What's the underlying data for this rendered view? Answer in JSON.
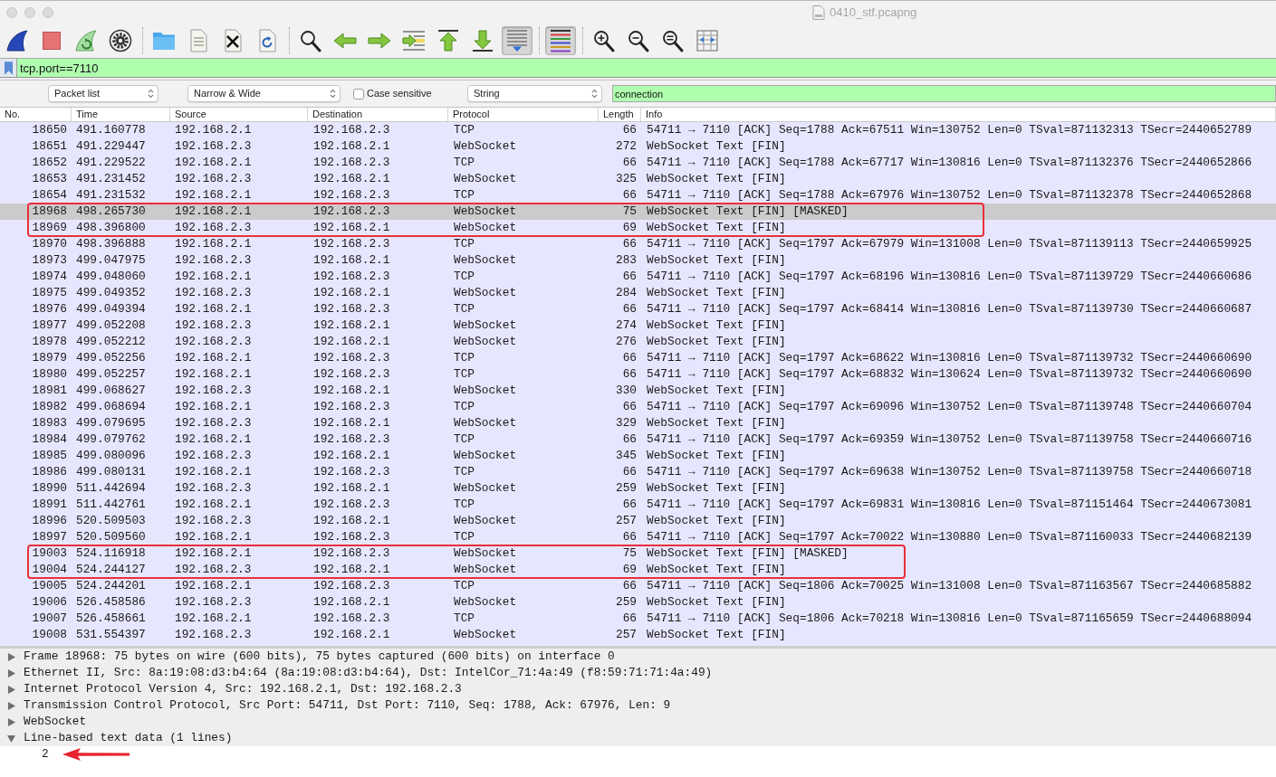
{
  "window": {
    "title": "0410_stf.pcapng"
  },
  "toolbar": [
    [
      {
        "pressed": false
      },
      {
        "pressed": false
      },
      {
        "pressed": false
      },
      {
        "pressed": false
      }
    ],
    [
      {
        "pressed": false
      },
      {
        "pressed": false
      },
      {
        "pressed": false
      },
      {
        "pressed": false
      }
    ],
    [
      {
        "pressed": false
      },
      {
        "pressed": false
      },
      {
        "pressed": false
      },
      {
        "pressed": false
      },
      {
        "pressed": false
      },
      {
        "pressed": false
      },
      {
        "pressed": true
      }
    ],
    [
      {
        "pressed": true
      }
    ],
    [
      {
        "pressed": false
      },
      {
        "pressed": false
      },
      {
        "pressed": false
      },
      {
        "pressed": false
      }
    ]
  ],
  "display_filter": {
    "value": "tcp.port==7110"
  },
  "find_bar": {
    "search_in": "Packet list",
    "char_width": "Narrow & Wide",
    "case_sensitive": {
      "label": "Case sensitive",
      "checked": false
    },
    "search_type": "String",
    "value": "connection"
  },
  "packet_list": {
    "columns": [
      "No.",
      "Time",
      "Source",
      "Destination",
      "Protocol",
      "Length",
      "Info"
    ],
    "rows": [
      {
        "cells": [
          "18650",
          "491.160778",
          "192.168.2.1",
          "192.168.2.3",
          "TCP",
          "66",
          "54711 → 7110 [ACK] Seq=1788 Ack=67511 Win=130752 Len=0 TSval=871132313 TSecr=2440652789"
        ],
        "selected": false,
        "boxed": false
      },
      {
        "cells": [
          "18651",
          "491.229447",
          "192.168.2.3",
          "192.168.2.1",
          "WebSocket",
          "272",
          "WebSocket Text [FIN]"
        ],
        "selected": false,
        "boxed": false
      },
      {
        "cells": [
          "18652",
          "491.229522",
          "192.168.2.1",
          "192.168.2.3",
          "TCP",
          "66",
          "54711 → 7110 [ACK] Seq=1788 Ack=67717 Win=130816 Len=0 TSval=871132376 TSecr=2440652866"
        ],
        "selected": false,
        "boxed": false
      },
      {
        "cells": [
          "18653",
          "491.231452",
          "192.168.2.3",
          "192.168.2.1",
          "WebSocket",
          "325",
          "WebSocket Text [FIN]"
        ],
        "selected": false,
        "boxed": false
      },
      {
        "cells": [
          "18654",
          "491.231532",
          "192.168.2.1",
          "192.168.2.3",
          "TCP",
          "66",
          "54711 → 7110 [ACK] Seq=1788 Ack=67976 Win=130752 Len=0 TSval=871132378 TSecr=2440652868"
        ],
        "selected": false,
        "boxed": false
      },
      {
        "cells": [
          "18968",
          "498.265730",
          "192.168.2.1",
          "192.168.2.3",
          "WebSocket",
          "75",
          "WebSocket Text [FIN] [MASKED]"
        ],
        "selected": true,
        "boxed": true
      },
      {
        "cells": [
          "18969",
          "498.396800",
          "192.168.2.3",
          "192.168.2.1",
          "WebSocket",
          "69",
          "WebSocket Text [FIN]"
        ],
        "selected": false,
        "boxed": true
      },
      {
        "cells": [
          "18970",
          "498.396888",
          "192.168.2.1",
          "192.168.2.3",
          "TCP",
          "66",
          "54711 → 7110 [ACK] Seq=1797 Ack=67979 Win=131008 Len=0 TSval=871139113 TSecr=2440659925"
        ],
        "selected": false,
        "boxed": false
      },
      {
        "cells": [
          "18973",
          "499.047975",
          "192.168.2.3",
          "192.168.2.1",
          "WebSocket",
          "283",
          "WebSocket Text [FIN]"
        ],
        "selected": false,
        "boxed": false
      },
      {
        "cells": [
          "18974",
          "499.048060",
          "192.168.2.1",
          "192.168.2.3",
          "TCP",
          "66",
          "54711 → 7110 [ACK] Seq=1797 Ack=68196 Win=130816 Len=0 TSval=871139729 TSecr=2440660686"
        ],
        "selected": false,
        "boxed": false
      },
      {
        "cells": [
          "18975",
          "499.049352",
          "192.168.2.3",
          "192.168.2.1",
          "WebSocket",
          "284",
          "WebSocket Text [FIN]"
        ],
        "selected": false,
        "boxed": false
      },
      {
        "cells": [
          "18976",
          "499.049394",
          "192.168.2.1",
          "192.168.2.3",
          "TCP",
          "66",
          "54711 → 7110 [ACK] Seq=1797 Ack=68414 Win=130816 Len=0 TSval=871139730 TSecr=2440660687"
        ],
        "selected": false,
        "boxed": false
      },
      {
        "cells": [
          "18977",
          "499.052208",
          "192.168.2.3",
          "192.168.2.1",
          "WebSocket",
          "274",
          "WebSocket Text [FIN]"
        ],
        "selected": false,
        "boxed": false
      },
      {
        "cells": [
          "18978",
          "499.052212",
          "192.168.2.3",
          "192.168.2.1",
          "WebSocket",
          "276",
          "WebSocket Text [FIN]"
        ],
        "selected": false,
        "boxed": false
      },
      {
        "cells": [
          "18979",
          "499.052256",
          "192.168.2.1",
          "192.168.2.3",
          "TCP",
          "66",
          "54711 → 7110 [ACK] Seq=1797 Ack=68622 Win=130816 Len=0 TSval=871139732 TSecr=2440660690"
        ],
        "selected": false,
        "boxed": false
      },
      {
        "cells": [
          "18980",
          "499.052257",
          "192.168.2.1",
          "192.168.2.3",
          "TCP",
          "66",
          "54711 → 7110 [ACK] Seq=1797 Ack=68832 Win=130624 Len=0 TSval=871139732 TSecr=2440660690"
        ],
        "selected": false,
        "boxed": false
      },
      {
        "cells": [
          "18981",
          "499.068627",
          "192.168.2.3",
          "192.168.2.1",
          "WebSocket",
          "330",
          "WebSocket Text [FIN]"
        ],
        "selected": false,
        "boxed": false
      },
      {
        "cells": [
          "18982",
          "499.068694",
          "192.168.2.1",
          "192.168.2.3",
          "TCP",
          "66",
          "54711 → 7110 [ACK] Seq=1797 Ack=69096 Win=130752 Len=0 TSval=871139748 TSecr=2440660704"
        ],
        "selected": false,
        "boxed": false
      },
      {
        "cells": [
          "18983",
          "499.079695",
          "192.168.2.3",
          "192.168.2.1",
          "WebSocket",
          "329",
          "WebSocket Text [FIN]"
        ],
        "selected": false,
        "boxed": false
      },
      {
        "cells": [
          "18984",
          "499.079762",
          "192.168.2.1",
          "192.168.2.3",
          "TCP",
          "66",
          "54711 → 7110 [ACK] Seq=1797 Ack=69359 Win=130752 Len=0 TSval=871139758 TSecr=2440660716"
        ],
        "selected": false,
        "boxed": false
      },
      {
        "cells": [
          "18985",
          "499.080096",
          "192.168.2.3",
          "192.168.2.1",
          "WebSocket",
          "345",
          "WebSocket Text [FIN]"
        ],
        "selected": false,
        "boxed": false
      },
      {
        "cells": [
          "18986",
          "499.080131",
          "192.168.2.1",
          "192.168.2.3",
          "TCP",
          "66",
          "54711 → 7110 [ACK] Seq=1797 Ack=69638 Win=130752 Len=0 TSval=871139758 TSecr=2440660718"
        ],
        "selected": false,
        "boxed": false
      },
      {
        "cells": [
          "18990",
          "511.442694",
          "192.168.2.3",
          "192.168.2.1",
          "WebSocket",
          "259",
          "WebSocket Text [FIN]"
        ],
        "selected": false,
        "boxed": false
      },
      {
        "cells": [
          "18991",
          "511.442761",
          "192.168.2.1",
          "192.168.2.3",
          "TCP",
          "66",
          "54711 → 7110 [ACK] Seq=1797 Ack=69831 Win=130816 Len=0 TSval=871151464 TSecr=2440673081"
        ],
        "selected": false,
        "boxed": false
      },
      {
        "cells": [
          "18996",
          "520.509503",
          "192.168.2.3",
          "192.168.2.1",
          "WebSocket",
          "257",
          "WebSocket Text [FIN]"
        ],
        "selected": false,
        "boxed": false
      },
      {
        "cells": [
          "18997",
          "520.509560",
          "192.168.2.1",
          "192.168.2.3",
          "TCP",
          "66",
          "54711 → 7110 [ACK] Seq=1797 Ack=70022 Win=130880 Len=0 TSval=871160033 TSecr=2440682139"
        ],
        "selected": false,
        "boxed": false
      },
      {
        "cells": [
          "19003",
          "524.116918",
          "192.168.2.1",
          "192.168.2.3",
          "WebSocket",
          "75",
          "WebSocket Text [FIN] [MASKED]"
        ],
        "selected": false,
        "boxed": true
      },
      {
        "cells": [
          "19004",
          "524.244127",
          "192.168.2.3",
          "192.168.2.1",
          "WebSocket",
          "69",
          "WebSocket Text [FIN]"
        ],
        "selected": false,
        "boxed": true
      },
      {
        "cells": [
          "19005",
          "524.244201",
          "192.168.2.1",
          "192.168.2.3",
          "TCP",
          "66",
          "54711 → 7110 [ACK] Seq=1806 Ack=70025 Win=131008 Len=0 TSval=871163567 TSecr=2440685882"
        ],
        "selected": false,
        "boxed": false
      },
      {
        "cells": [
          "19006",
          "526.458586",
          "192.168.2.3",
          "192.168.2.1",
          "WebSocket",
          "259",
          "WebSocket Text [FIN]"
        ],
        "selected": false,
        "boxed": false
      },
      {
        "cells": [
          "19007",
          "526.458661",
          "192.168.2.1",
          "192.168.2.3",
          "TCP",
          "66",
          "54711 → 7110 [ACK] Seq=1806 Ack=70218 Win=130816 Len=0 TSval=871165659 TSecr=2440688094"
        ],
        "selected": false,
        "boxed": false
      },
      {
        "cells": [
          "19008",
          "531.554397",
          "192.168.2.3",
          "192.168.2.1",
          "WebSocket",
          "257",
          "WebSocket Text [FIN]"
        ],
        "selected": false,
        "boxed": false
      }
    ]
  },
  "details": [
    {
      "text": "Frame 18968: 75 bytes on wire (600 bits), 75 bytes captured (600 bits) on interface 0",
      "expanded": false
    },
    {
      "text": "Ethernet II, Src: 8a:19:08:d3:b4:64 (8a:19:08:d3:b4:64), Dst: IntelCor_71:4a:49 (f8:59:71:71:4a:49)",
      "expanded": false
    },
    {
      "text": "Internet Protocol Version 4, Src: 192.168.2.1, Dst: 192.168.2.3",
      "expanded": false
    },
    {
      "text": "Transmission Control Protocol, Src Port: 54711, Dst Port: 7110, Seq: 1788, Ack: 67976, Len: 9",
      "expanded": false
    },
    {
      "text": "WebSocket",
      "expanded": false
    },
    {
      "text": "Line-based text data (1 lines)",
      "expanded": true,
      "children": [
        {
          "text": "2",
          "arrow": true
        }
      ]
    }
  ]
}
